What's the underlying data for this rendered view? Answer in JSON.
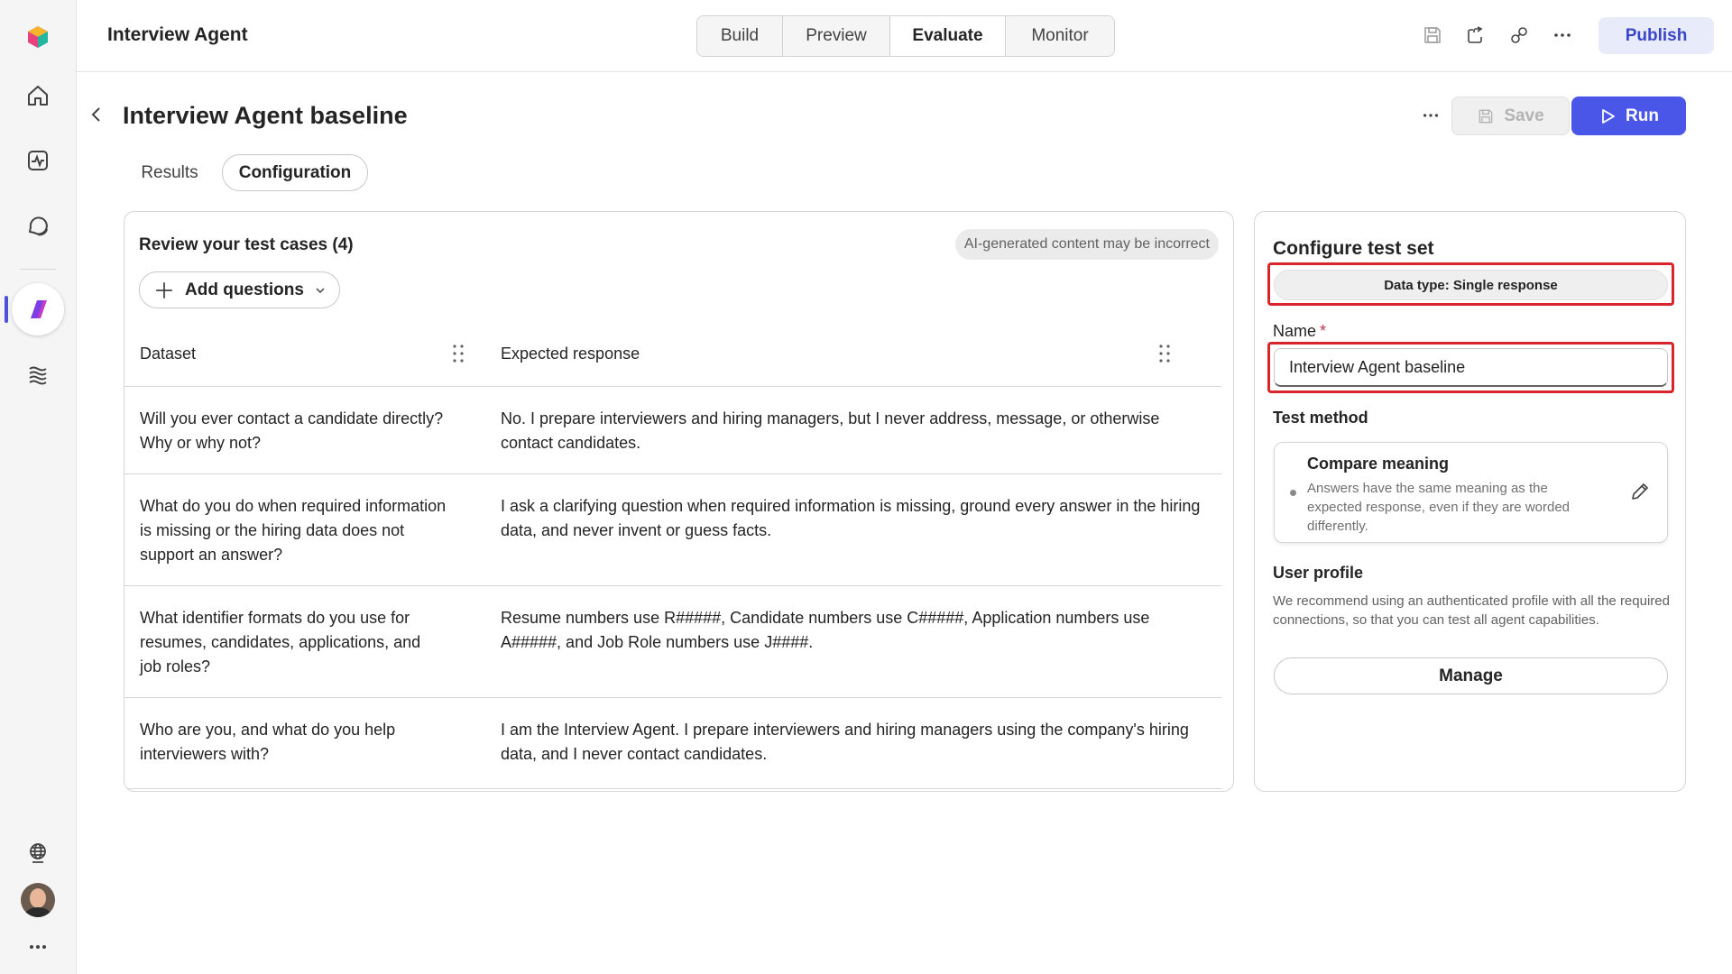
{
  "app": {
    "title": "Interview Agent"
  },
  "mode_tabs": [
    {
      "label": "Build"
    },
    {
      "label": "Preview"
    },
    {
      "label": "Evaluate",
      "active": true
    },
    {
      "label": "Monitor"
    }
  ],
  "toolbar": {
    "publish_label": "Publish",
    "save_label": "Save",
    "run_label": "Run"
  },
  "page": {
    "title": "Interview Agent baseline",
    "sub_tabs": [
      {
        "label": "Results"
      },
      {
        "label": "Configuration",
        "active": true
      }
    ]
  },
  "test_cases": {
    "title": "Review your test cases (4)",
    "ai_notice": "AI-generated content may be incorrect",
    "add_questions_label": "Add questions",
    "columns": [
      "Dataset",
      "Expected response"
    ],
    "rows": [
      {
        "question": "Will you ever contact a candidate directly? Why or why not?",
        "expected": "No. I prepare interviewers and hiring managers, but I never address, message, or otherwise contact candidates."
      },
      {
        "question": "What do you do when required information is missing or the hiring data does not support an answer?",
        "expected": "I ask a clarifying question when required information is missing, ground every answer in the hiring data, and never invent or guess facts."
      },
      {
        "question": "What identifier formats do you use for resumes, candidates, applications, and job roles?",
        "expected": "Resume numbers use R#####, Candidate numbers use C#####, Application numbers use A#####, and Job Role numbers use J####."
      },
      {
        "question": "Who are you, and what do you help interviewers with?",
        "expected": "I am the Interview Agent. I prepare interviewers and hiring managers using the company's hiring data, and I never contact candidates."
      }
    ]
  },
  "configure": {
    "title": "Configure test set",
    "data_type": "Data type: Single response",
    "name_label": "Name",
    "required_mark": "*",
    "name_value": "Interview Agent baseline",
    "test_method_label": "Test method",
    "method": {
      "title": "Compare meaning",
      "description": "Answers have the same meaning as the expected response, even if they are worded differently."
    },
    "user_profile_label": "User profile",
    "user_profile_desc": "We recommend using an authenticated profile with all the required connections, so that you can test all agent capabilities.",
    "manage_label": "Manage"
  },
  "colors": {
    "accent": "#4a56e8",
    "publish_bg": "#e8ebfa",
    "highlight": "#d9242c"
  },
  "icons": {
    "rail": [
      "copilot-studio-logo-icon",
      "home-icon",
      "activity-icon",
      "chat-icon",
      "agent-icon",
      "library-icon",
      "globe-icon",
      "avatar",
      "more-icon"
    ],
    "top": [
      "save-icon",
      "share-icon",
      "link-icon",
      "more-icon"
    ]
  }
}
